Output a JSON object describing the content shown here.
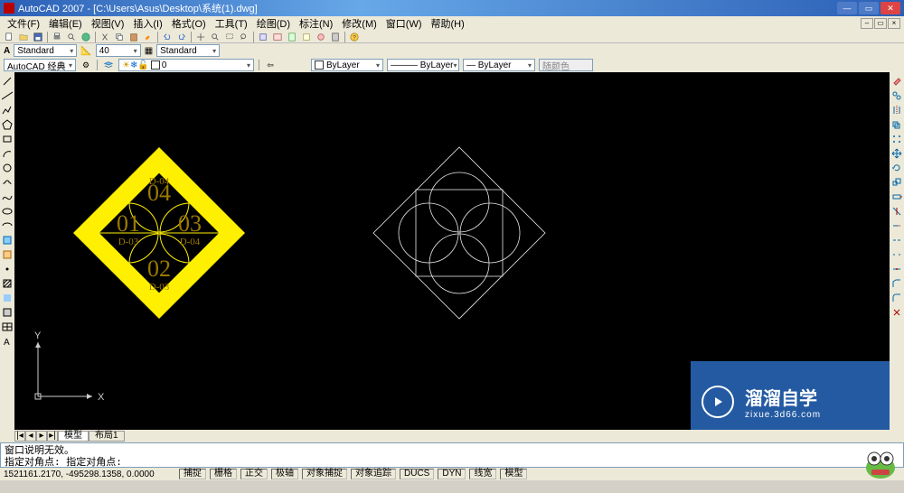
{
  "title": "AutoCAD 2007 - [C:\\Users\\Asus\\Desktop\\系统(1).dwg]",
  "menus": [
    "文件(F)",
    "编辑(E)",
    "视图(V)",
    "插入(I)",
    "格式(O)",
    "工具(T)",
    "绘图(D)",
    "标注(N)",
    "修改(M)",
    "窗口(W)",
    "帮助(H)"
  ],
  "style_row": {
    "style": "Standard",
    "dim": "40",
    "dimstyle": "Standard"
  },
  "workspace_row": {
    "workspace": "AutoCAD 经典",
    "layer": "0",
    "layer_combo": "□ 0"
  },
  "prop_row": {
    "bylayer1": "ByLayer",
    "bylayer2": "ByLayer",
    "bylayer3": "ByLayer",
    "color": "随颜色"
  },
  "ucs": {
    "x": "X",
    "y": "Y"
  },
  "tabs": {
    "model": "模型",
    "layout1": "布局1"
  },
  "cmd": {
    "line1": "窗口说明无效。",
    "line2": "指定对角点: 指定对角点:"
  },
  "status": {
    "coord": "1521161.2170, -495298.1358, 0.0000",
    "modes": [
      "捕捉",
      "栅格",
      "正交",
      "极轴",
      "对象捕捉",
      "对象追踪",
      "DUCS",
      "DYN",
      "线宽",
      "模型"
    ]
  },
  "drawing": {
    "labels": {
      "top": "D-04",
      "left": "D-03",
      "right": "D-04",
      "bottom": "D-03",
      "c1": "01",
      "c2": "04",
      "c3": "03",
      "c4": "02"
    }
  },
  "watermark": {
    "brand": "溜溜自学",
    "sub": "zixue.3d66.com"
  }
}
